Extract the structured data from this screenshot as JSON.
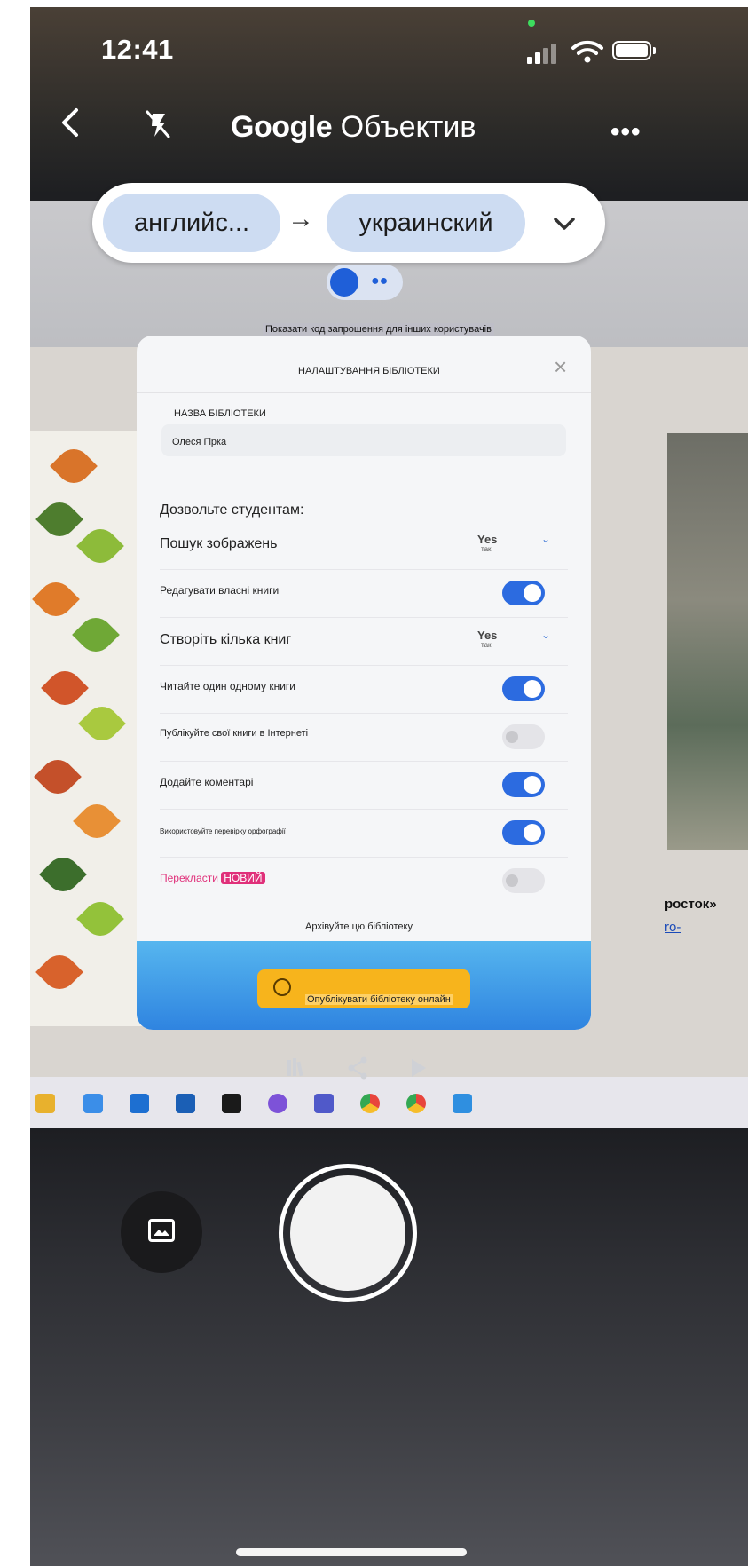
{
  "status_bar": {
    "time": "12:41"
  },
  "toolbar": {
    "title_brand": "Google",
    "title_product": "Объектив",
    "more_label": "•••"
  },
  "language_bar": {
    "source": "английс...",
    "arrow": "→",
    "target": "украинский"
  },
  "dialog": {
    "invite_text": "Показати код запрошення для інших користувачів",
    "title": "НАЛАШТУВАННЯ БІБЛІОТЕКИ",
    "name_label": "НАЗВА БІБЛІОТЕКИ",
    "name_value": "Олеся Гірка",
    "allow_label": "Дозвольте студентам:",
    "rows": [
      {
        "label": "Пошук зображень",
        "type": "select",
        "value": "Yes",
        "value_translation": "так"
      },
      {
        "label": "Редагувати власні книги",
        "type": "toggle",
        "state": "on"
      },
      {
        "label": "Створіть кілька книг",
        "type": "select",
        "value": "Yes",
        "value_translation": "так"
      },
      {
        "label": "Читайте один одному книги",
        "type": "toggle",
        "state": "on"
      },
      {
        "label": "Публікуйте свої книги в Інтернеті",
        "type": "toggle",
        "state": "off"
      },
      {
        "label": "Додайте коментарі",
        "type": "toggle",
        "state": "on"
      },
      {
        "label": "Використовуйте перевірку орфографії",
        "type": "toggle",
        "state": "on"
      },
      {
        "label": "Перекласти",
        "badge": "НОВИЙ",
        "type": "toggle",
        "state": "off"
      }
    ],
    "archive_label": "Архівуйте цю бібліотеку",
    "publish_label": "Опублікувати бібліотеку онлайн"
  },
  "background": {
    "right_text_1": "росток»",
    "right_text_2": "ro-"
  },
  "colors": {
    "accent_blue": "#2c6be0",
    "chip_blue": "#cddcf2",
    "publish_yellow": "#f7b41c",
    "badge_pink": "#e0307a"
  },
  "icons": [
    "back-arrow-icon",
    "flash-off-icon",
    "more-icon",
    "chevron-down-icon",
    "gallery-icon",
    "globe-icon",
    "close-icon",
    "library-icon",
    "share-icon",
    "play-icon"
  ]
}
